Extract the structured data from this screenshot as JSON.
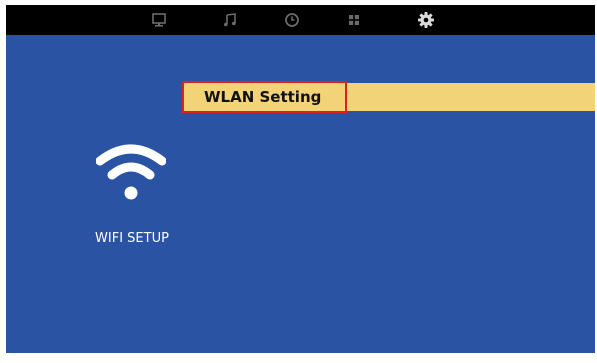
{
  "top_bar": {
    "icons": [
      {
        "name": "monitor-icon",
        "active": false
      },
      {
        "name": "music-note-icon",
        "active": false
      },
      {
        "name": "clock-icon",
        "active": false
      },
      {
        "name": "grid-icon",
        "active": false
      },
      {
        "name": "gear-icon",
        "active": true
      }
    ]
  },
  "menu": {
    "items": [
      {
        "label": "WLAN Setting",
        "selected": true
      }
    ]
  },
  "section": {
    "icon": "wifi-icon",
    "label": "WIFI SETUP"
  },
  "colors": {
    "screen_background": "#2b53a3",
    "top_bar": "#000000",
    "highlight": "#f3d377",
    "focus_outline": "#e02020"
  }
}
